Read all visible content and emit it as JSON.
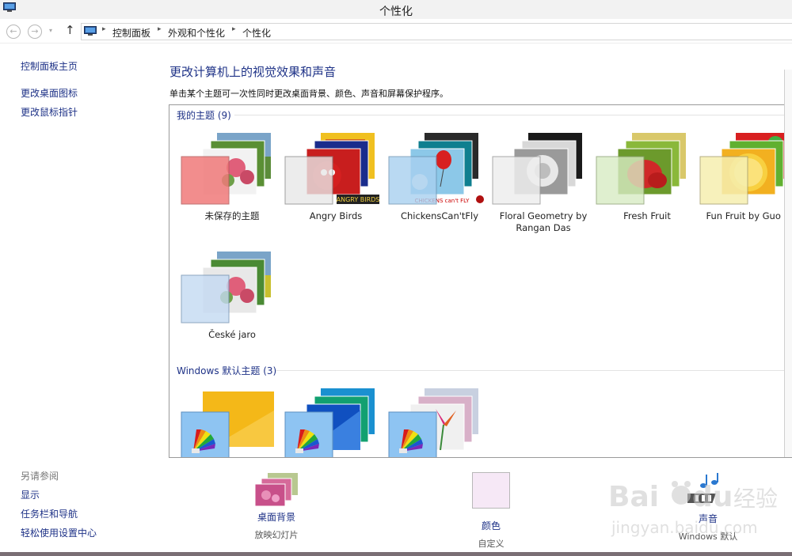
{
  "window": {
    "title": "个性化"
  },
  "nav": {
    "back": "←",
    "forward": "→",
    "recent": "▾",
    "up": "↑",
    "breadcrumbs": [
      "控制面板",
      "外观和个性化",
      "个性化"
    ],
    "separator": "▸"
  },
  "sidebar": {
    "links": [
      "控制面板主页",
      "更改桌面图标",
      "更改鼠标指针"
    ],
    "see_also_label": "另请参阅",
    "see_also": [
      "显示",
      "任务栏和导航",
      "轻松使用设置中心"
    ]
  },
  "main": {
    "heading": "更改计算机上的视觉效果和声音",
    "subtitle": "单击某个主题可一次性同时更改桌面背景、颜色、声音和屏幕保护程序。",
    "my_themes": {
      "label": "我的主题 (9)",
      "items": [
        {
          "label": "未保存的主题",
          "icon": "unsaved-theme-icon",
          "accent": "#f07a7a"
        },
        {
          "label": "Angry Birds",
          "icon": "angry-birds-theme-icon",
          "accent": "#e8e8e8"
        },
        {
          "label": "ChickensCan'tFly",
          "icon": "chickens-theme-icon",
          "accent": "#a8d0f0"
        },
        {
          "label": "Floral Geometry by Rangan Das",
          "icon": "floral-geometry-theme-icon",
          "accent": "#eeeeee"
        },
        {
          "label": "Fresh Fruit",
          "icon": "fresh-fruit-theme-icon",
          "accent": "#d8ecc4"
        },
        {
          "label": "Fun Fruit by Guo Bo",
          "icon": "fun-fruit-theme-icon",
          "accent": "#f6efb0"
        },
        {
          "label": "České jaro",
          "icon": "ceske-jaro-theme-icon",
          "accent": "#c4daf2"
        }
      ]
    },
    "default_themes": {
      "label": "Windows 默认主题 (3)",
      "items": [
        {
          "icon": "windows-theme-icon",
          "accent": "#8ec4f2"
        },
        {
          "icon": "lines-and-colors-theme-icon",
          "accent": "#8ec4f2"
        },
        {
          "icon": "flowers-theme-icon",
          "accent": "#8ec4f2"
        }
      ]
    }
  },
  "bottom": {
    "background": {
      "label": "桌面背景",
      "sub": "放映幻灯片",
      "icon": "desktop-background-icon"
    },
    "color": {
      "label": "颜色",
      "sub": "自定义",
      "icon": "color-icon",
      "swatch": "#f6e8f6"
    },
    "sound": {
      "label": "声音",
      "sub": "Windows 默认",
      "icon": "sound-icon"
    }
  }
}
